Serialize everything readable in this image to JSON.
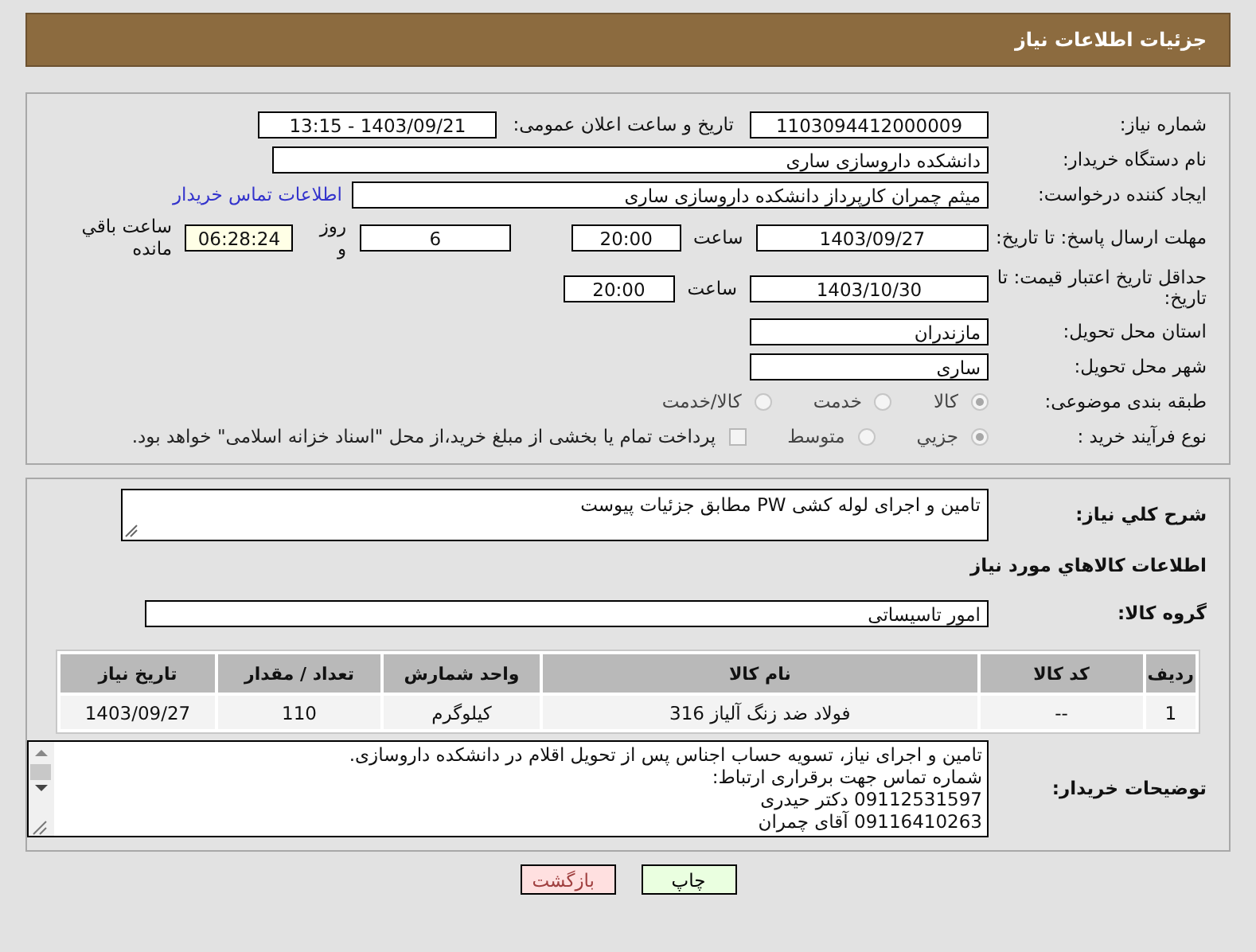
{
  "header": {
    "title": "جزئیات اطلاعات نیاز"
  },
  "form": {
    "need_number": {
      "label": "شماره نیاز:",
      "value": "1103094412000009"
    },
    "announce": {
      "label": "تاریخ و ساعت اعلان عمومی:",
      "value": "1403/09/21 - 13:15"
    },
    "buyer": {
      "label": "نام دستگاه خریدار:",
      "value": "دانشکده داروسازی ساری"
    },
    "creator": {
      "label": "ایجاد کننده درخواست:",
      "value": "میثم  چمران کارپرداز دانشکده داروسازی ساری",
      "link": "اطلاعات تماس خریدار"
    },
    "deadline": {
      "label": "مهلت ارسال پاسخ: تا تاریخ:",
      "date": "1403/09/27",
      "time_label": "ساعت",
      "time": "20:00",
      "days": "6",
      "days_label": "روز و",
      "remaining": "06:28:24",
      "remaining_label": "ساعت باقي مانده"
    },
    "validity": {
      "label": "حداقل تاریخ اعتبار قیمت: تا تاریخ:",
      "date": "1403/10/30",
      "time_label": "ساعت",
      "time": "20:00"
    },
    "province": {
      "label": "استان محل تحویل:",
      "value": "مازندران"
    },
    "city": {
      "label": "شهر محل تحویل:",
      "value": "ساری"
    },
    "category": {
      "label": "طبقه بندی موضوعی:",
      "options": [
        {
          "label": "کالا",
          "selected": true
        },
        {
          "label": "خدمت",
          "selected": false
        },
        {
          "label": "کالا/خدمت",
          "selected": false
        }
      ]
    },
    "process": {
      "label": "نوع فرآیند خرید :",
      "options": [
        {
          "label": "جزیي",
          "selected": true
        },
        {
          "label": "متوسط",
          "selected": false
        }
      ],
      "treasury": {
        "label": "پرداخت تمام یا بخشی از مبلغ خرید،از محل \"اسناد خزانه اسلامی\" خواهد بود.",
        "checked": false
      }
    }
  },
  "details": {
    "description": {
      "label": "شرح کلي نیاز:",
      "value": "تامین و اجرای لوله کشی PW مطابق جزئیات پیوست"
    },
    "goods_heading": "اطلاعات کالاهاي مورد نیاز",
    "group": {
      "label": "گروه کالا:",
      "value": "امور تاسیساتی"
    },
    "table": {
      "columns": [
        "ردیف",
        "کد کالا",
        "نام کالا",
        "واحد شمارش",
        "تعداد / مقدار",
        "تاریخ نیاز"
      ],
      "rows": [
        [
          "1",
          "--",
          "فولاد ضد زنگ آلیاز 316",
          "کیلوگرم",
          "110",
          "1403/09/27"
        ]
      ]
    },
    "notes": {
      "label": "توضیحات خریدار:",
      "lines": [
        "تامین و اجرای نیاز، تسویه حساب اجناس پس از تحویل اقلام در دانشکده داروسازی.",
        "شماره تماس جهت برقراری ارتباط:",
        "09112531597 دکتر حیدری",
        "09116410263 آقای چمران"
      ]
    }
  },
  "buttons": [
    {
      "label": "چاپ",
      "kind": "print"
    },
    {
      "label": "بازگشت",
      "kind": "back"
    }
  ]
}
